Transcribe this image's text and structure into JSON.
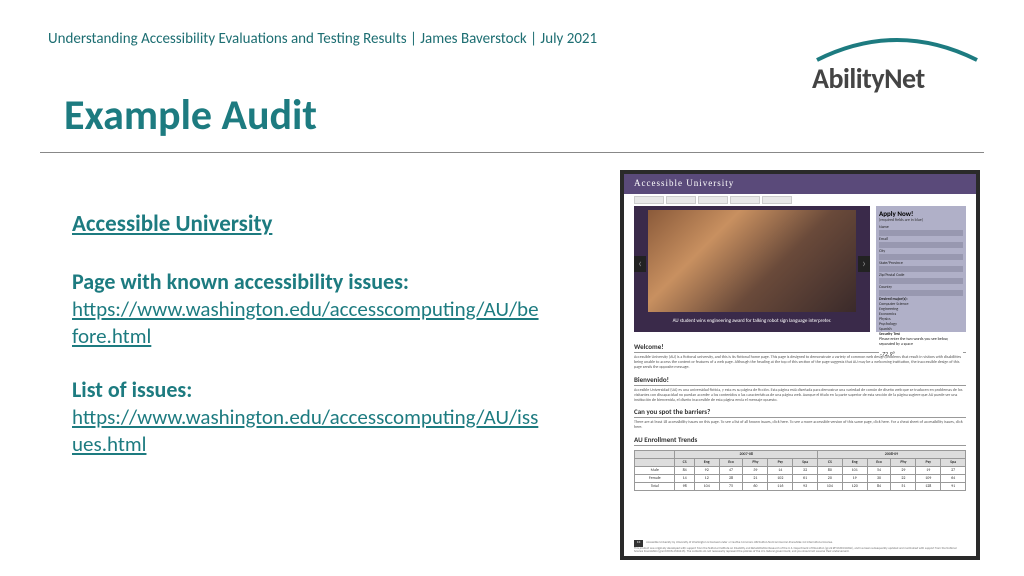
{
  "header": "Understanding Accessibility Evaluations and Testing Results | James Baverstock | July 2021",
  "logo": {
    "text": "AbilityNet"
  },
  "title": "Example Audit",
  "content": {
    "heading_link": "Accessible University",
    "block1": {
      "label": "Page with known accessibility issues:",
      "url": "https://www.washington.edu/accesscomputing/AU/before.html"
    },
    "block2": {
      "label": "List of issues:",
      "url": "https://www.washington.edu/accesscomputing/AU/issues.html"
    }
  },
  "thumb": {
    "site_title": "Accessible University",
    "carousel_caption": "AU student wins engineering award for talking robot sign language interpreter.",
    "form": {
      "title": "Apply Now!",
      "sub": "(required fields are in blue)",
      "fields": [
        "Name",
        "Email",
        "City",
        "State/Province",
        "Zip/Postal Code",
        "Country"
      ],
      "majors_label": "Desired major(s):",
      "majors": [
        "Computer Science",
        "Engineering",
        "Economics",
        "Physics",
        "Psychology",
        "Spanish"
      ],
      "security_label": "Security Test",
      "security_text": "Please enter the two words you see below, separated by a space",
      "captcha": "-72.9°"
    },
    "sections": {
      "welcome_h": "Welcome!",
      "welcome_p": "Accessible University (AU) is a fictional university, and this is its fictional home page. This page is designed to demonstrate a variety of common web design problems that result in visitors with disabilities being unable to access the content or features of a web page. Although the heading at the top of this section of the page suggests that AU may be a welcoming institution, the inaccessible design of this page sends the opposite message.",
      "bien_h": "Bienvenido!",
      "bien_p": "Accesible Universidad (UA) es una universidad ficticia, y esta es su página de ficción. Esta página está diseñada para demostrar una variedad de común de diseño web que se traducen en problemas de los visitantes con discapacidad no puedan acceder a los contenidos o las características de una página web. Aunque el título en la parte superior de esta sección de la página sugiere que AU puede ser una institución de bienvenida, el diseño inaccesible de esta página envía el mensaje opuesto.",
      "spot_h": "Can you spot the barriers?",
      "spot_p": "There are at least 18 accessibility issues on this page. To see a list of all known issues, click here. To see a more accessible version of this same page, click here. For a cheat sheet of accessibility issues, click here.",
      "enroll_h": "AU Enrollment Trends"
    },
    "table": {
      "year_headers": [
        "2007-08",
        "2008-09"
      ],
      "cols": [
        "",
        "CS",
        "Eng",
        "Eco",
        "Phy",
        "Psy",
        "Spa",
        "CS",
        "Eng",
        "Eco",
        "Phy",
        "Psy",
        "Spa"
      ],
      "rows": [
        [
          "Male",
          "84",
          "92",
          "47",
          "39",
          "14",
          "32",
          "80",
          "101",
          "54",
          "29",
          "19",
          "27"
        ],
        [
          "Female",
          "14",
          "12",
          "28",
          "21",
          "102",
          "61",
          "20",
          "19",
          "30",
          "22",
          "109",
          "64"
        ],
        [
          "Total",
          "98",
          "104",
          "75",
          "60",
          "116",
          "93",
          "104",
          "120",
          "84",
          "51",
          "128",
          "91"
        ]
      ]
    },
    "footer": {
      "cc": "cc",
      "line1": "Accessible University by University of Washington is licensed under a Creative Commons Attribution-NonCommercial-ShareAlike 4.0 International License.",
      "line2": "This product was originally developed with support from the National Institute on Disability and Rehabilitation Research of the U.S. Department of Education (grant #H133D010306), and has been subsequently updated and maintained with support from the National Science Foundation (grant #CNS-0540615). The contents do not necessarily represent the policies of the U.S. federal government, and you should not assume their endorsement."
    }
  }
}
